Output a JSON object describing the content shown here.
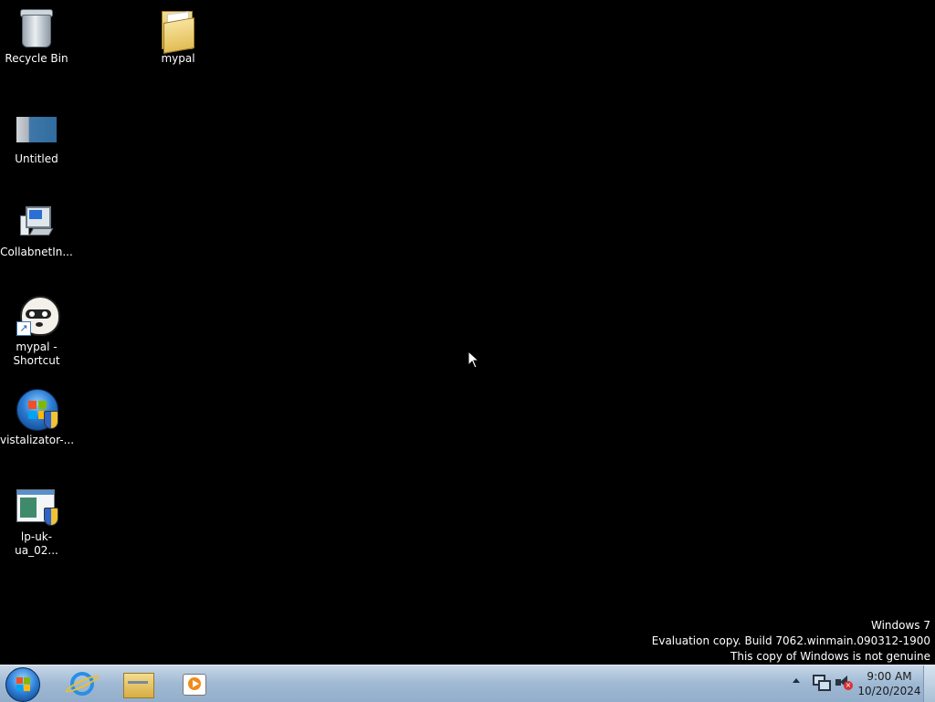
{
  "desktop": {
    "icons": [
      {
        "id": "recycle-bin",
        "label": "Recycle Bin"
      },
      {
        "id": "mypal-folder",
        "label": "mypal"
      },
      {
        "id": "untitled",
        "label": "Untitled"
      },
      {
        "id": "collabnet",
        "label": "CollabnetIn..."
      },
      {
        "id": "mypal-shortcut",
        "label": "mypal -\nShortcut"
      },
      {
        "id": "vistalizator",
        "label": "vistalizator-..."
      },
      {
        "id": "lp-uk-ua",
        "label": "lp-uk-ua_02..."
      }
    ],
    "watermark": {
      "line1": "Windows 7",
      "line2": "Evaluation copy. Build 7062.winmain.090312-1900",
      "line3": "This copy of Windows is not genuine"
    }
  },
  "taskbar": {
    "pinned": [
      {
        "icon": "internet-explorer-icon"
      },
      {
        "icon": "windows-explorer-icon"
      },
      {
        "icon": "media-player-icon"
      }
    ],
    "tray": {
      "time": "9:00 AM",
      "date": "10/20/2024",
      "icons": [
        "show-hidden-icons-arrow",
        "network-icon",
        "volume-muted-icon"
      ]
    }
  },
  "colors": {
    "desktop_background": "#000000",
    "taskbar": "#a7bfd8"
  }
}
